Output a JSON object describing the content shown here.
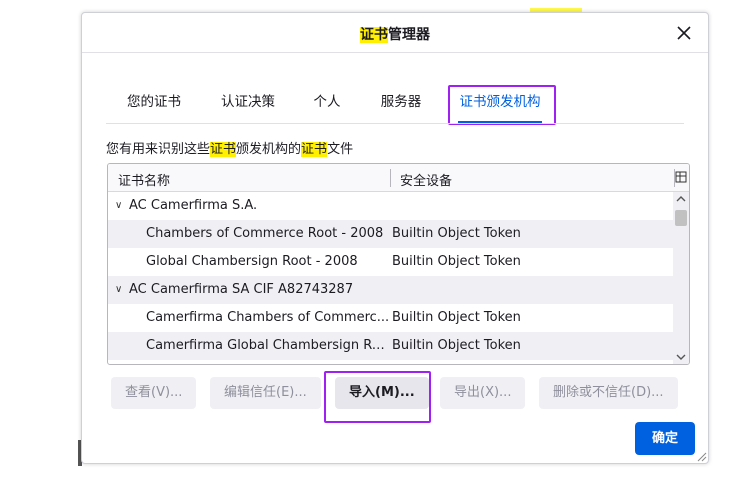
{
  "dialog": {
    "title_highlight": "证书",
    "title_rest": "管理器",
    "close_symbol": "×"
  },
  "tabs": [
    {
      "label": "您的证书"
    },
    {
      "label": "认证决策"
    },
    {
      "label": "个人"
    },
    {
      "label": "服务器"
    },
    {
      "label": "证书颁发机构"
    }
  ],
  "description": {
    "part1": "您有用来识别这些",
    "hl1": "证书",
    "part2": "颁发机构的",
    "hl2": "证书",
    "part3": "文件"
  },
  "table": {
    "columns": [
      "证书名称",
      "安全设备"
    ],
    "rows": [
      {
        "kind": "group",
        "twisty": "∨",
        "name": "AC Camerfirma S.A."
      },
      {
        "kind": "item",
        "name": "Chambers of Commerce Root - 2008",
        "device": "Builtin Object Token"
      },
      {
        "kind": "item",
        "name": "Global Chambersign Root - 2008",
        "device": "Builtin Object Token"
      },
      {
        "kind": "group",
        "twisty": "∨",
        "name": "AC Camerfirma SA CIF A82743287"
      },
      {
        "kind": "item",
        "name": "Camerfirma Chambers of Commerc...",
        "device": "Builtin Object Token"
      },
      {
        "kind": "item",
        "name": "Camerfirma Global Chambersign Ro...",
        "device": "Builtin Object Token"
      }
    ]
  },
  "buttons": {
    "view": "查看(V)...",
    "edit_trust": "编辑信任(E)...",
    "import": "导入(M)...",
    "export": "导出(X)...",
    "delete": "删除或不信任(D)...",
    "ok": "确定"
  },
  "colors": {
    "accent": "#0061e0",
    "highlight": "#ffef00",
    "annotation_box": "#a020f0"
  }
}
